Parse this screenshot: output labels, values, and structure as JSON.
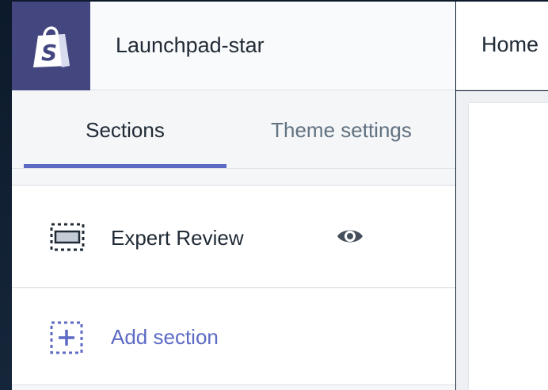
{
  "store": {
    "name": "Launchpad-star",
    "logo_icon": "shopify-bag-icon"
  },
  "tabs": [
    {
      "label": "Sections",
      "active": true
    },
    {
      "label": "Theme settings",
      "active": false
    }
  ],
  "sections": {
    "items": [
      {
        "label": "Expert Review",
        "icon": "section-placeholder-icon",
        "visibility_icon": "eye-icon"
      }
    ],
    "add_label": "Add section",
    "add_icon": "add-section-icon"
  },
  "preview": {
    "page_title": "Home"
  },
  "colors": {
    "logo_bg": "#43467f",
    "accent": "#5c6ac4",
    "text": "#212b36",
    "muted": "#637381"
  }
}
